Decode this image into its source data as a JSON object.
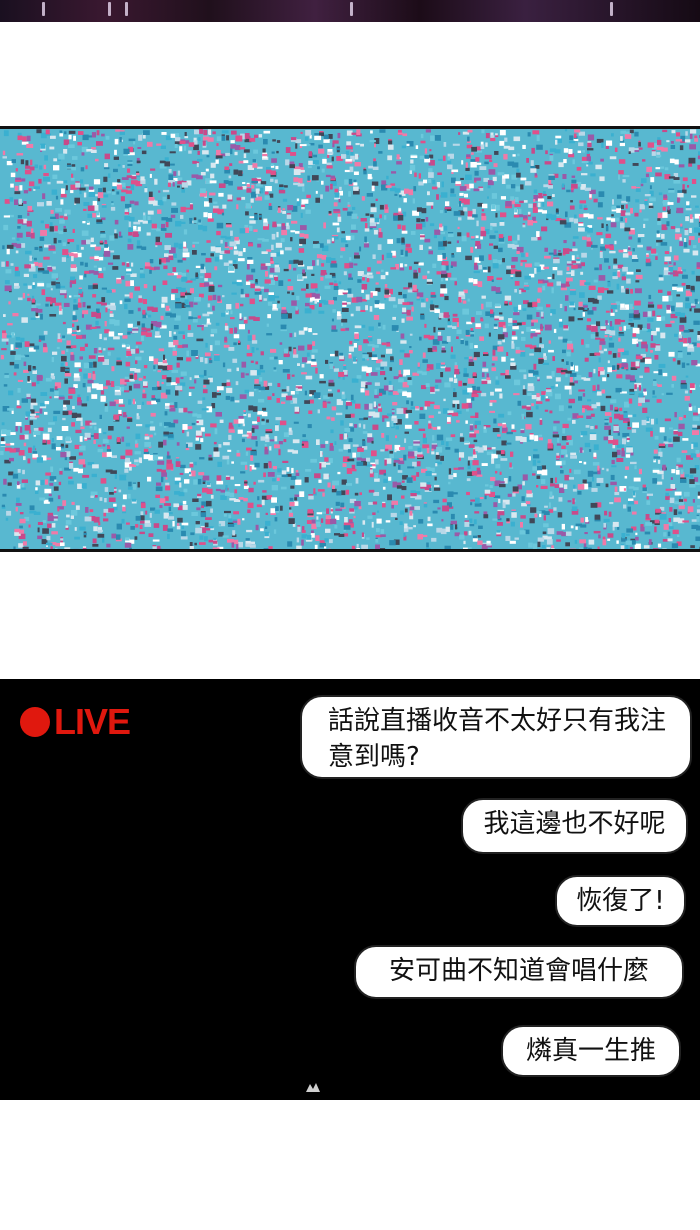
{
  "live_badge": {
    "text": "LIVE",
    "color": "#e0180e"
  },
  "chat": [
    {
      "text": "話說直播收音不太好只有我注意到嗎?"
    },
    {
      "text": "我這邊也不好呢"
    },
    {
      "text": "恢復了!"
    },
    {
      "text": "安可曲不知道會唱什麼"
    },
    {
      "text": "燐真一生推"
    }
  ],
  "colors": {
    "static_primary": "#58b8d0",
    "static_secondary": "#e0508a",
    "screen_bg": "#000000"
  }
}
